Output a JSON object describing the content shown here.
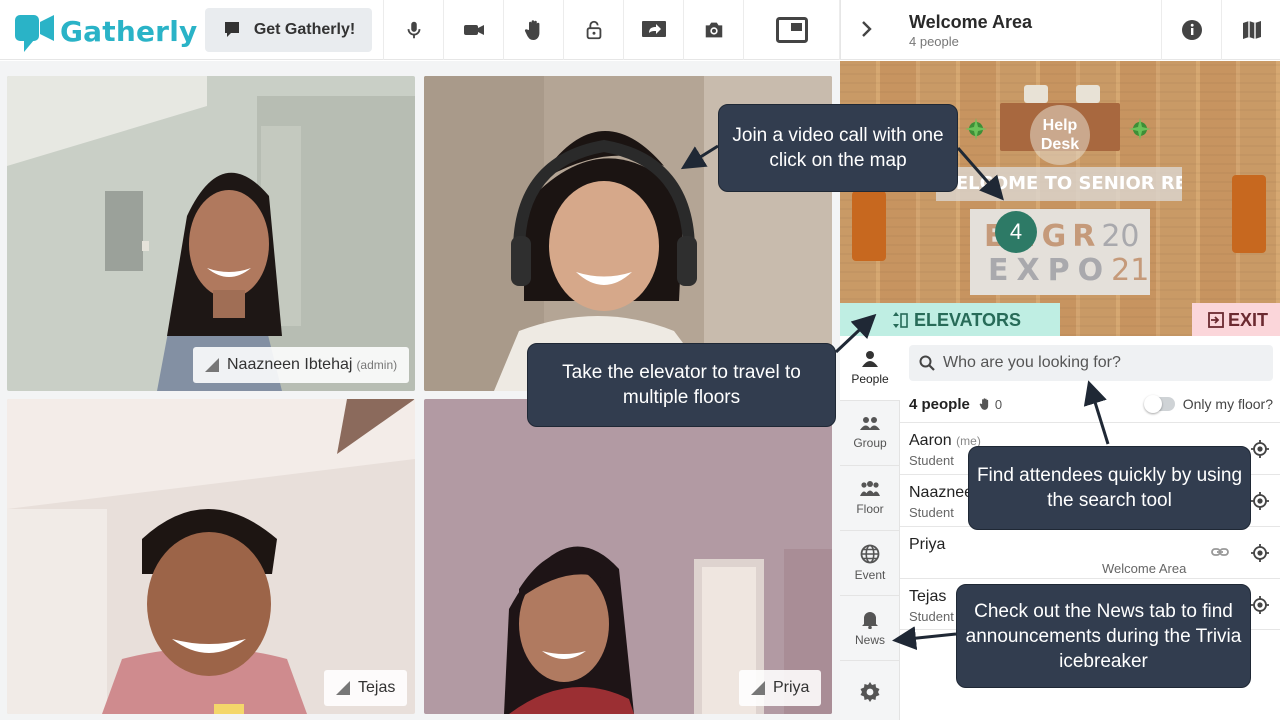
{
  "brand": {
    "name": "Gatherly",
    "accent": "#2ab3c7"
  },
  "toolbar": {
    "get_button_label": "Get Gatherly!",
    "icons": [
      "microphone-icon",
      "camera-icon",
      "raise-hand-icon",
      "lock-icon",
      "share-screen-icon",
      "snapshot-icon",
      "picture-in-picture-icon"
    ]
  },
  "videos": [
    {
      "name": "Naazneen Ibtehaj",
      "role": "(admin)"
    },
    {
      "name": ""
    },
    {
      "name": "Tejas"
    },
    {
      "name": "Priya"
    }
  ],
  "sidebar": {
    "title": "Welcome Area",
    "subtitle": "4 people"
  },
  "map": {
    "help_desk": "Help Desk",
    "banner": "WELCOME TO SENIOR RECEPTION!",
    "expo_line1": "ENGR",
    "expo_year1": "20",
    "expo_line2": "EXPO",
    "expo_year2": "21",
    "group_count": "4",
    "elevators_label": "ELEVATORS",
    "exit_label": "EXIT"
  },
  "nav": [
    {
      "label": "People",
      "icon": "person-icon"
    },
    {
      "label": "Group",
      "icon": "group-icon"
    },
    {
      "label": "Floor",
      "icon": "floor-icon"
    },
    {
      "label": "Event",
      "icon": "globe-icon"
    },
    {
      "label": "News",
      "icon": "bell-icon"
    },
    {
      "label": "",
      "icon": "settings-icon"
    }
  ],
  "people_panel": {
    "search_placeholder": "Who are you looking for?",
    "count_label": "4 people",
    "hands_raised": "0",
    "toggle_label": "Only my floor?",
    "people": [
      {
        "name": "Aaron",
        "tag": "(me)",
        "role": "Student",
        "location": ""
      },
      {
        "name": "Naazneen",
        "tag": "",
        "role": "Student",
        "location": ""
      },
      {
        "name": "Priya",
        "tag": "",
        "role": "",
        "location": "Welcome Area"
      },
      {
        "name": "Tejas",
        "tag": "",
        "role": "Student",
        "location": ""
      }
    ]
  },
  "callouts": {
    "video_call": "Join a video call with one click on the map",
    "elevator": "Take the elevator to travel to multiple  floors",
    "search": "Find attendees quickly by using the search tool",
    "news": "Check out the News tab to find announcements  during the Trivia icebreaker"
  }
}
